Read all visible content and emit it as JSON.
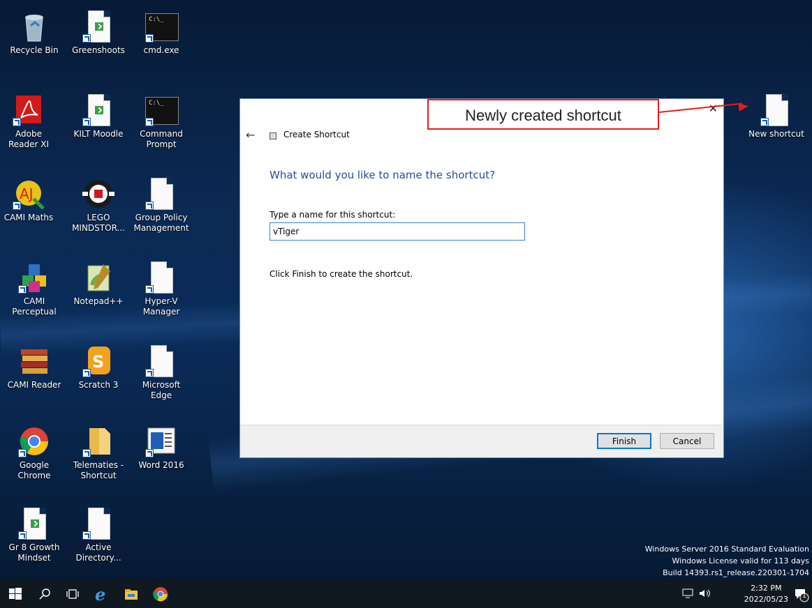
{
  "desktop": {
    "icons": [
      {
        "label": "Recycle Bin",
        "icon": "recycle-bin-icon"
      },
      {
        "label": "Greenshoots",
        "icon": "shortcut-file-icon"
      },
      {
        "label": "cmd.exe",
        "icon": "console-icon"
      },
      {
        "label": "Adobe Reader XI",
        "icon": "adobe-reader-icon"
      },
      {
        "label": "KILT Moodle",
        "icon": "shortcut-file-icon"
      },
      {
        "label": "Command Prompt",
        "icon": "console-icon"
      },
      {
        "label": "CAMI Maths",
        "icon": "cami-maths-icon"
      },
      {
        "label": "LEGO MINDSTOR...",
        "icon": "lego-mindstorms-icon"
      },
      {
        "label": "Group Policy Management",
        "icon": "blank-file-icon"
      },
      {
        "label": "CAMI Perceptual",
        "icon": "cami-perceptual-icon"
      },
      {
        "label": "Notepad++",
        "icon": "notepadpp-icon"
      },
      {
        "label": "Hyper-V Manager",
        "icon": "blank-file-icon"
      },
      {
        "label": "CAMI Reader",
        "icon": "books-icon"
      },
      {
        "label": "Scratch 3",
        "icon": "scratch-icon"
      },
      {
        "label": "Microsoft Edge",
        "icon": "blank-file-icon"
      },
      {
        "label": "Google Chrome",
        "icon": "chrome-icon"
      },
      {
        "label": "Telematies - Shortcut",
        "icon": "folder-icon"
      },
      {
        "label": "Word 2016",
        "icon": "word-icon"
      },
      {
        "label": "Gr 8 Growth Mindset",
        "icon": "shortcut-file-icon"
      },
      {
        "label": "Active Directory...",
        "icon": "blank-file-icon"
      },
      {
        "label": "New shortcut",
        "icon": "blank-file-icon"
      }
    ]
  },
  "dialog": {
    "title": "Create Shortcut",
    "question": "What would you like to name the shortcut?",
    "prompt": "Type a name for this shortcut:",
    "name_value": "vTiger",
    "hint": "Click Finish to create the shortcut.",
    "finish_label": "Finish",
    "cancel_label": "Cancel",
    "close_glyph": "✕",
    "back_glyph": "←"
  },
  "annotation": {
    "text": "Newly created shortcut",
    "color": "#e21d1d"
  },
  "watermark": {
    "line1": "Windows Server 2016 Standard Evaluation",
    "line2": "Windows License valid for 113 days",
    "line3": "Build 14393.rs1_release.220301-1704"
  },
  "taskbar": {
    "time": "2:32 PM",
    "date": "2022/05/23",
    "notification_count": "1"
  }
}
